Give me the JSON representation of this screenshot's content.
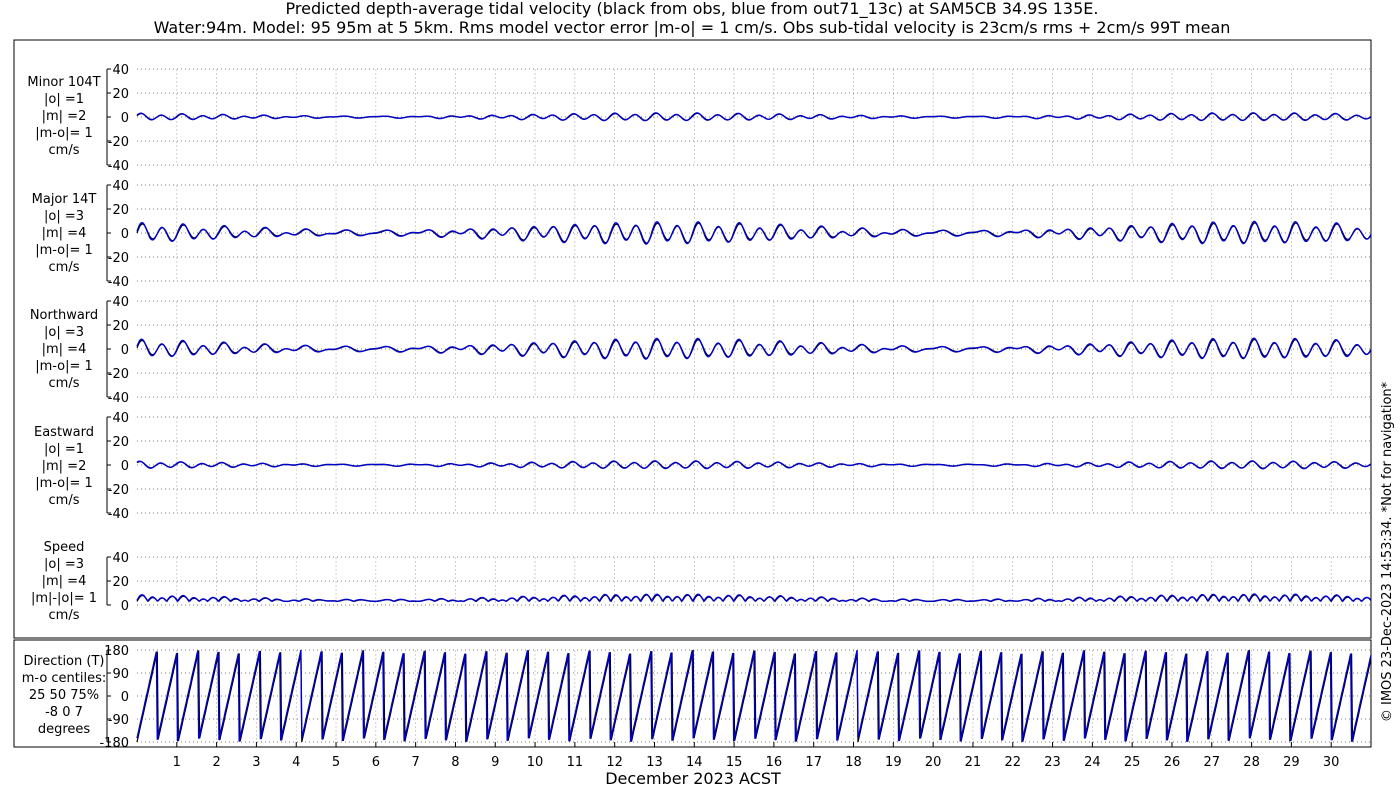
{
  "title_line1": "Predicted depth-average tidal velocity (black from obs, blue from out71_13c) at SAM5CB 34.9S 135E.",
  "title_line2": "Water:94m. Model: 95 95m at 5 5km. Rms model vector error |m-o| = 1 cm/s. Obs sub-tidal velocity is 23cm/s rms + 2cm/s 99T mean",
  "xlabel": "December 2023 ACST",
  "credit": "© IMOS 23-Dec-2023 14:53:34. *Not for navigation*",
  "colors": {
    "obs": "#000000",
    "model": "#0000cc",
    "grid": "#b4b4b4"
  },
  "chart_data": {
    "type": "line",
    "x_unit": "day of December 2023 (ACST)",
    "x_range": [
      0,
      31
    ],
    "x_ticks": [
      "1",
      "2",
      "3",
      "4",
      "5",
      "6",
      "7",
      "8",
      "9",
      "10",
      "11",
      "12",
      "13",
      "14",
      "15",
      "16",
      "17",
      "18",
      "19",
      "20",
      "21",
      "22",
      "23",
      "24",
      "25",
      "26",
      "27",
      "28",
      "29",
      "30"
    ],
    "series_legend": [
      {
        "name": "obs",
        "color": "#000000"
      },
      {
        "name": "out71_13c",
        "color": "#0000cc"
      }
    ],
    "panels": [
      {
        "key": "minor",
        "label": [
          "Minor 104T",
          "|o| =1",
          "|m| =2",
          "|m-o|= 1",
          "cm/s"
        ],
        "ylim": [
          -40,
          40
        ],
        "yticks": [
          "40",
          "20",
          "0",
          "-20",
          "-40"
        ],
        "yvals": [
          40,
          20,
          0,
          -20,
          -40
        ],
        "amp": 2.5,
        "mean": 0,
        "kind": "signed",
        "phase": 0.3
      },
      {
        "key": "major",
        "label": [
          "Major 14T",
          "|o| =3",
          "|m| =4",
          "|m-o|= 1",
          "cm/s"
        ],
        "ylim": [
          -40,
          40
        ],
        "yticks": [
          "40",
          "20",
          "0",
          "-20",
          "-40"
        ],
        "yvals": [
          40,
          20,
          0,
          -20,
          -40
        ],
        "amp": 7,
        "mean": 0,
        "kind": "signed",
        "phase": 0
      },
      {
        "key": "north",
        "label": [
          "Northward",
          "|o| =3",
          "|m| =4",
          "|m-o|= 1",
          "cm/s"
        ],
        "ylim": [
          -40,
          40
        ],
        "yticks": [
          "40",
          "20",
          "0",
          "-20",
          "-40"
        ],
        "yvals": [
          40,
          20,
          0,
          -20,
          -40
        ],
        "amp": 6.5,
        "mean": 0,
        "kind": "signed",
        "phase": 0.1
      },
      {
        "key": "east",
        "label": [
          "Eastward",
          "|o| =1",
          "|m| =2",
          "|m-o|= 1",
          "cm/s"
        ],
        "ylim": [
          -40,
          40
        ],
        "yticks": [
          "40",
          "20",
          "0",
          "-20",
          "-40"
        ],
        "yvals": [
          40,
          20,
          0,
          -20,
          -40
        ],
        "amp": 2.5,
        "mean": 0,
        "kind": "signed",
        "phase": 0.6
      },
      {
        "key": "speed",
        "label": [
          "Speed",
          "|o| =3",
          "|m| =4",
          "|m|-|o|= 1",
          "cm/s"
        ],
        "ylim": [
          0,
          40
        ],
        "yticks": [
          "40",
          "20",
          "0"
        ],
        "yvals": [
          40,
          20,
          0
        ],
        "amp": 6,
        "mean": 3,
        "kind": "speed",
        "phase": 0
      },
      {
        "key": "direction",
        "label": [
          "Direction (T)",
          "m-o centiles:",
          "25  50  75%",
          "-8   0   7",
          "degrees"
        ],
        "ylim": [
          -180,
          180
        ],
        "yticks": [
          "180",
          "90",
          "0",
          "-90",
          "-180"
        ],
        "yvals": [
          180,
          90,
          0,
          -90,
          -180
        ],
        "amp": 180,
        "mean": 0,
        "kind": "direction",
        "phase": 0
      }
    ]
  }
}
